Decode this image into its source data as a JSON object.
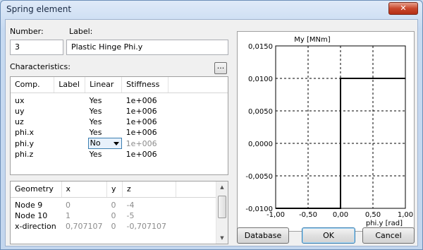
{
  "window": {
    "title": "Spring element",
    "close_label": "✕"
  },
  "form": {
    "number_label": "Number:",
    "number_value": "3",
    "label_label": "Label:",
    "label_value": "Plastic Hinge Phi.y",
    "characteristics_label": "Characteristics:",
    "browse_label": "..."
  },
  "characteristics": {
    "columns": [
      "Comp.",
      "Label",
      "Linear",
      "Stiffness"
    ],
    "rows": [
      {
        "comp": "ux",
        "label": "",
        "linear": "Yes",
        "stiffness": "1e+006"
      },
      {
        "comp": "uy",
        "label": "",
        "linear": "Yes",
        "stiffness": "1e+006"
      },
      {
        "comp": "uz",
        "label": "",
        "linear": "Yes",
        "stiffness": "1e+006"
      },
      {
        "comp": "phi.x",
        "label": "",
        "linear": "Yes",
        "stiffness": "1e+006"
      },
      {
        "comp": "phi.y",
        "label": "",
        "linear": "No",
        "stiffness": "1e+006"
      },
      {
        "comp": "phi.z",
        "label": "",
        "linear": "Yes",
        "stiffness": "1e+006"
      }
    ]
  },
  "geometry": {
    "columns": [
      "Geometry",
      "x",
      "y",
      "z"
    ],
    "rows": [
      {
        "name": "Node 9",
        "x": "0",
        "y": "0",
        "z": "-4"
      },
      {
        "name": "Node 10",
        "x": "1",
        "y": "0",
        "z": "-5"
      },
      {
        "name": "x-direction",
        "x": "0,707107",
        "y": "0",
        "z": "-0,707107"
      }
    ]
  },
  "chart_data": {
    "type": "line",
    "ylabel": "My [MNm]",
    "xlabel": "phi.y [rad]",
    "x_ticks": [
      "-1,00",
      "-0,50",
      "0,00",
      "0,50",
      "1,00"
    ],
    "y_ticks": [
      "0,0150",
      "0,0100",
      "0,0050",
      "0,0000",
      "-0,0050",
      "-0,0100"
    ],
    "xlim": [
      -1.0,
      1.0
    ],
    "ylim": [
      -0.01,
      0.015
    ],
    "grid": true,
    "series": [
      {
        "x": [
          -1.0,
          0.0,
          0.0,
          1.0
        ],
        "y": [
          -0.01,
          -0.01,
          0.01,
          0.01
        ]
      }
    ]
  },
  "buttons": {
    "database": "Database",
    "ok": "OK",
    "cancel": "Cancel"
  }
}
